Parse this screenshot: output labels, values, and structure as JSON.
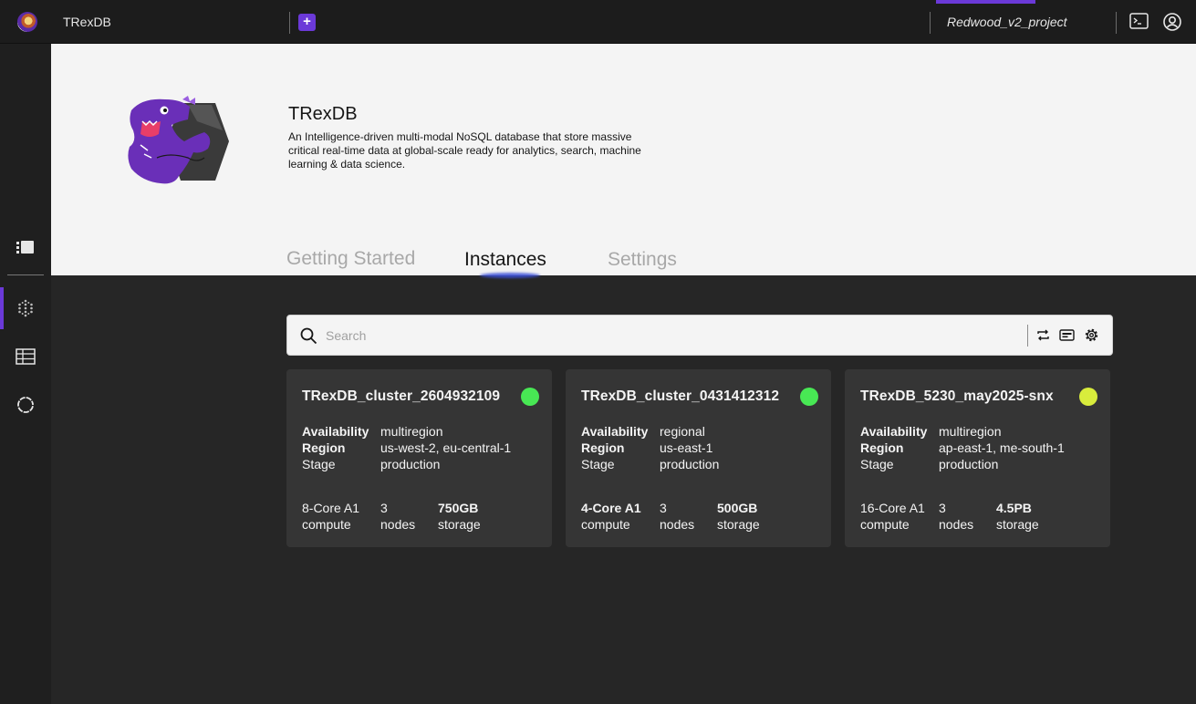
{
  "topbar": {
    "app_title": "TRexDB",
    "add_label": "+",
    "project_name": "Redwood_v2_project"
  },
  "sidebar": {
    "items": [
      {
        "icon": "list-icon"
      },
      {
        "icon": "network-icon"
      },
      {
        "icon": "table-icon"
      },
      {
        "icon": "settings-ring-icon"
      }
    ]
  },
  "product": {
    "title": "TRexDB",
    "description": "An Intelligence-driven multi-modal NoSQL database that store massive critical real-time data at global-scale ready for analytics, search, machine learning & data science."
  },
  "tabs": [
    {
      "label": "Getting Started"
    },
    {
      "label": "Instances"
    },
    {
      "label": "Settings"
    }
  ],
  "search": {
    "placeholder": "Search",
    "value": ""
  },
  "labels": {
    "availability": "Availability",
    "region": "Region",
    "stage": "Stage"
  },
  "colors": {
    "accent": "#6b39d8",
    "status_green": "#48e854",
    "status_yellow": "#d8ec3c"
  },
  "clusters": [
    {
      "name": "TRexDB_cluster_2604932109",
      "status_color": "#48e854",
      "availability": "multiregion",
      "region": "us-west-2, eu-central-1",
      "stage": "production",
      "compute_value": "8-Core A1",
      "compute_label": "compute",
      "nodes_value": "3",
      "nodes_label": "nodes",
      "storage_value": "750GB",
      "storage_label": "storage"
    },
    {
      "name": "TRexDB_cluster_0431412312",
      "status_color": "#48e854",
      "availability": "regional",
      "region": "us-east-1",
      "stage": "production",
      "compute_value": "4-Core A1",
      "compute_label": "compute",
      "nodes_value": "3",
      "nodes_label": "nodes",
      "storage_value": "500GB",
      "storage_label": "storage"
    },
    {
      "name": "TRexDB_5230_may2025-snx",
      "status_color": "#d8ec3c",
      "availability": "multiregion",
      "region": "ap-east-1, me-south-1",
      "stage": "production",
      "compute_value": "16-Core A1",
      "compute_label": "compute",
      "nodes_value": "3",
      "nodes_label": "nodes",
      "storage_value": "4.5PB",
      "storage_label": "storage"
    }
  ]
}
